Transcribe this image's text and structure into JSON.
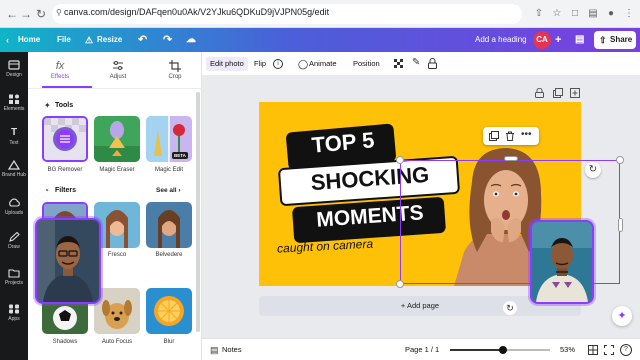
{
  "browser": {
    "url": "canva.com/design/DAFqen0u0Ak/V2YJku6QDKuD9jVJPN05g/edit"
  },
  "topbar": {
    "home": "Home",
    "file": "File",
    "resize": "Resize",
    "add_heading": "Add a heading",
    "avatar": "CA",
    "share": "Share"
  },
  "rail": {
    "items": [
      "Design",
      "Elements",
      "Text",
      "Brand Hub",
      "Uploads",
      "Draw",
      "Projects",
      "Apps"
    ]
  },
  "panel": {
    "tabs": [
      "Effects",
      "Adjust",
      "Crop"
    ],
    "tools_title": "Tools",
    "tools": [
      "BG Remover",
      "Magic Eraser",
      "Magic Edit"
    ],
    "beta_badge": "BETA",
    "filters_title": "Filters",
    "see_all": "See all",
    "filters_row1": [
      "",
      "Fresco",
      "Belvedere"
    ],
    "filters_row2": [
      "Shadows",
      "Auto Focus",
      "Blur"
    ]
  },
  "toolbar": {
    "edit_photo": "Edit photo",
    "flip": "Flip",
    "animate": "Animate",
    "position": "Position"
  },
  "canvas": {
    "line1": "TOP 5",
    "line2": "SHOCKING",
    "line3": "MOMENTS",
    "line4": "caught on camera"
  },
  "workspace": {
    "add_page": "+ Add page"
  },
  "bottombar": {
    "notes": "Notes",
    "page": "Page 1 / 1",
    "zoom": "53%",
    "zoom_level": 0.53
  },
  "colors": {
    "accent": "#8b3dff",
    "canvas_bg": "#ffc107",
    "avatar": "#e23456"
  }
}
